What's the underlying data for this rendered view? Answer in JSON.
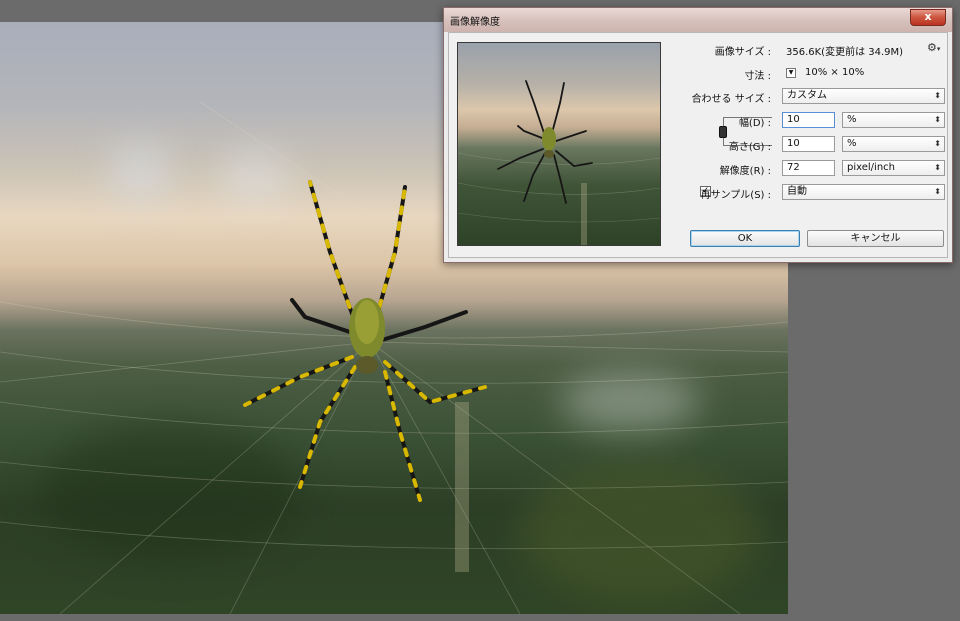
{
  "dialog": {
    "title": "画像解像度",
    "close_label": "x",
    "image_size_label": "画像サイズ :",
    "image_size_value": "356.6K(変更前は 34.9M)",
    "dimensions_label": "寸法 :",
    "dimensions_value": "10% × 10%",
    "fit_to_label": "合わせる サイズ :",
    "fit_to_value": "カスタム",
    "width_label": "幅(D) :",
    "width_value": "10",
    "width_unit": "%",
    "height_label": "高さ(G) :",
    "height_value": "10",
    "height_unit": "%",
    "resolution_label": "解像度(R) :",
    "resolution_value": "72",
    "resolution_unit": "pixel/inch",
    "resample_label": "再サンプル(S) :",
    "resample_checked": true,
    "resample_value": "自動",
    "ok_label": "OK",
    "cancel_label": "キャンセル"
  },
  "icons": {
    "settings": "gear-icon",
    "close": "close-icon",
    "constrain": "link-chain-icon",
    "dropdown": "chevron-down-icon",
    "checkmark": "checkmark-icon"
  },
  "colors": {
    "workspace_bg": "#6b6b6b",
    "dialog_bg": "#f0f0f0",
    "titlebar": "#d8c2bd",
    "close_button": "#cf5a44",
    "default_button_border": "#3c7fb1"
  }
}
